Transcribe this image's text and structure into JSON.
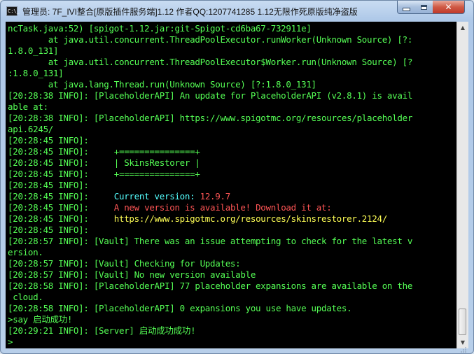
{
  "window": {
    "title": "管理员:  7F_IVI整合[原版插件服务端]1.12 作者QQ:1207741285 1.12无限作死原版纯净盗版",
    "icon_text": "C:\\_",
    "icons": {
      "app": "console-icon",
      "min": "minimize-icon",
      "max": "maximize-icon",
      "close": "close-icon"
    }
  },
  "colors": {
    "console_bg": "#000000",
    "text_green": "#55ff55",
    "text_cyan": "#55ffff",
    "text_red": "#ff5555",
    "text_yellow": "#ffff55"
  },
  "console": {
    "lines": [
      {
        "segments": [
          {
            "text": "ncTask.java:52) [spigot-1.12.jar:git-Spigot-cd6ba67-732911e]",
            "color": "#55ff55"
          }
        ]
      },
      {
        "segments": [
          {
            "text": "        at java.util.concurrent.ThreadPoolExecutor.runWorker(Unknown Source) [?:",
            "color": "#55ff55"
          }
        ]
      },
      {
        "segments": [
          {
            "text": "1.8.0_131]",
            "color": "#55ff55"
          }
        ]
      },
      {
        "segments": [
          {
            "text": "        at java.util.concurrent.ThreadPoolExecutor$Worker.run(Unknown Source) [?",
            "color": "#55ff55"
          }
        ]
      },
      {
        "segments": [
          {
            "text": ":1.8.0_131]",
            "color": "#55ff55"
          }
        ]
      },
      {
        "segments": [
          {
            "text": "        at java.lang.Thread.run(Unknown Source) [?:1.8.0_131]",
            "color": "#55ff55"
          }
        ]
      },
      {
        "segments": [
          {
            "text": "[20:28:38 INFO]: [PlaceholderAPI] An update for PlaceholderAPI (v2.8.1) is avail",
            "color": "#55ff55"
          }
        ]
      },
      {
        "segments": [
          {
            "text": "able at:",
            "color": "#55ff55"
          }
        ]
      },
      {
        "segments": [
          {
            "text": "[20:28:38 INFO]: [PlaceholderAPI] https://www.spigotmc.org/resources/placeholder",
            "color": "#55ff55"
          }
        ]
      },
      {
        "segments": [
          {
            "text": "api.6245/",
            "color": "#55ff55"
          }
        ]
      },
      {
        "segments": [
          {
            "text": "[20:28:45 INFO]:",
            "color": "#55ff55"
          }
        ]
      },
      {
        "segments": [
          {
            "text": "[20:28:45 INFO]:     ",
            "color": "#55ff55"
          },
          {
            "text": "+===============+",
            "color": "#55ff55"
          }
        ]
      },
      {
        "segments": [
          {
            "text": "[20:28:45 INFO]:     ",
            "color": "#55ff55"
          },
          {
            "text": "| SkinsRestorer |",
            "color": "#55ff55"
          }
        ]
      },
      {
        "segments": [
          {
            "text": "[20:28:45 INFO]:     ",
            "color": "#55ff55"
          },
          {
            "text": "+===============+",
            "color": "#55ff55"
          }
        ]
      },
      {
        "segments": [
          {
            "text": "[20:28:45 INFO]:",
            "color": "#55ff55"
          }
        ]
      },
      {
        "segments": [
          {
            "text": "[20:28:45 INFO]:     ",
            "color": "#55ff55"
          },
          {
            "text": "Current version: ",
            "color": "#55ffff"
          },
          {
            "text": "12.9.7",
            "color": "#ff5555"
          }
        ]
      },
      {
        "segments": [
          {
            "text": "[20:28:45 INFO]:     ",
            "color": "#55ff55"
          },
          {
            "text": "A new version is available! Download it at:",
            "color": "#ff5555"
          }
        ]
      },
      {
        "segments": [
          {
            "text": "[20:28:45 INFO]:     ",
            "color": "#55ff55"
          },
          {
            "text": "https://www.spigotmc.org/resources/skinsrestorer.2124/",
            "color": "#ffff55"
          }
        ]
      },
      {
        "segments": [
          {
            "text": "[20:28:45 INFO]:",
            "color": "#55ff55"
          }
        ]
      },
      {
        "segments": [
          {
            "text": "[20:28:57 INFO]: [Vault] There was an issue attempting to check for the latest v",
            "color": "#55ff55"
          }
        ]
      },
      {
        "segments": [
          {
            "text": "ersion.",
            "color": "#55ff55"
          }
        ]
      },
      {
        "segments": [
          {
            "text": "[20:28:57 INFO]: [Vault] Checking for Updates:",
            "color": "#55ff55"
          }
        ]
      },
      {
        "segments": [
          {
            "text": "[20:28:57 INFO]: [Vault] No new version available",
            "color": "#55ff55"
          }
        ]
      },
      {
        "segments": [
          {
            "text": "[20:28:58 INFO]: [PlaceholderAPI] 77 placeholder expansions are available on the",
            "color": "#55ff55"
          }
        ]
      },
      {
        "segments": [
          {
            "text": " cloud.",
            "color": "#55ff55"
          }
        ]
      },
      {
        "segments": [
          {
            "text": "[20:28:58 INFO]: [PlaceholderAPI] 0 expansions you use have updates.",
            "color": "#55ff55"
          }
        ]
      },
      {
        "segments": [
          {
            "text": ">say 启动成功!",
            "color": "#55ff55"
          }
        ]
      },
      {
        "segments": [
          {
            "text": "[20:29:21 INFO]: [Server] 启动成功成功!",
            "color": "#55ff55"
          }
        ]
      },
      {
        "segments": [
          {
            "text": ">",
            "color": "#55ff55"
          }
        ]
      }
    ]
  },
  "scrollbar": {
    "up_glyph": "▲",
    "down_glyph": "▼"
  }
}
